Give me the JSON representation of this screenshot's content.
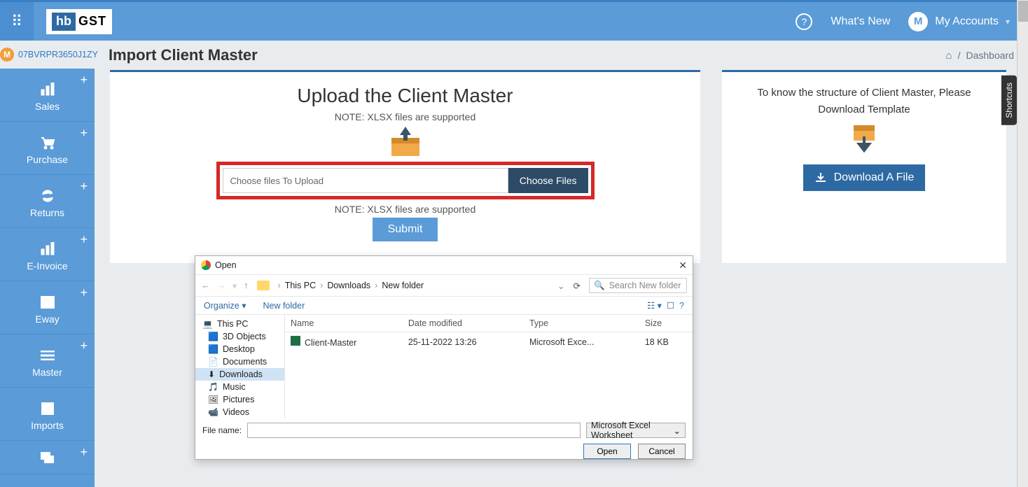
{
  "header": {
    "logo_hb": "hb",
    "logo_gst": "GST",
    "whats_new": "What's New",
    "avatar_initial": "M",
    "account_label": "My Accounts"
  },
  "org": {
    "initial": "M",
    "id": "07BVRPR3650J1ZY"
  },
  "sidebar": {
    "items": [
      {
        "label": "Sales",
        "plus": true
      },
      {
        "label": "Purchase",
        "plus": true
      },
      {
        "label": "Returns",
        "plus": true
      },
      {
        "label": "E-Invoice",
        "plus": true
      },
      {
        "label": "Eway",
        "plus": true
      },
      {
        "label": "Master",
        "plus": true
      },
      {
        "label": "Imports",
        "plus": false
      },
      {
        "label": "",
        "plus": true
      }
    ]
  },
  "page": {
    "title": "Import Client Master",
    "breadcrumb_sep": "/",
    "breadcrumb_item": "Dashboard"
  },
  "main": {
    "upload_title": "Upload the Client Master",
    "note": "NOTE: XLSX files are supported",
    "choose_placeholder": "Choose files To Upload",
    "choose_button": "Choose Files",
    "submit": "Submit"
  },
  "right": {
    "text": "To know the structure of Client Master, Please Download Template",
    "download_button": "Download A File"
  },
  "shortcuts_label": "Shortcuts",
  "dialog": {
    "title": "Open",
    "crumbs": [
      "This PC",
      "Downloads",
      "New folder"
    ],
    "refresh": "⟳",
    "search_placeholder": "Search New folder",
    "organize": "Organize",
    "new_folder": "New folder",
    "tree": [
      {
        "label": "This PC",
        "icon": "💻",
        "indent": 10
      },
      {
        "label": "3D Objects",
        "icon": "🟦",
        "indent": 18
      },
      {
        "label": "Desktop",
        "icon": "🟦",
        "indent": 18
      },
      {
        "label": "Documents",
        "icon": "📄",
        "indent": 18
      },
      {
        "label": "Downloads",
        "icon": "⬇",
        "indent": 18,
        "selected": true
      },
      {
        "label": "Music",
        "icon": "🎵",
        "indent": 18
      },
      {
        "label": "Pictures",
        "icon": "🖼",
        "indent": 18
      },
      {
        "label": "Videos",
        "icon": "📹",
        "indent": 18
      }
    ],
    "columns": [
      "Name",
      "Date modified",
      "Type",
      "Size"
    ],
    "rows": [
      {
        "name": "Client-Master",
        "date": "25-11-2022 13:26",
        "type": "Microsoft Exce...",
        "size": "18 KB"
      }
    ],
    "file_name_label": "File name:",
    "filter": "Microsoft Excel Worksheet",
    "open": "Open",
    "cancel": "Cancel"
  }
}
